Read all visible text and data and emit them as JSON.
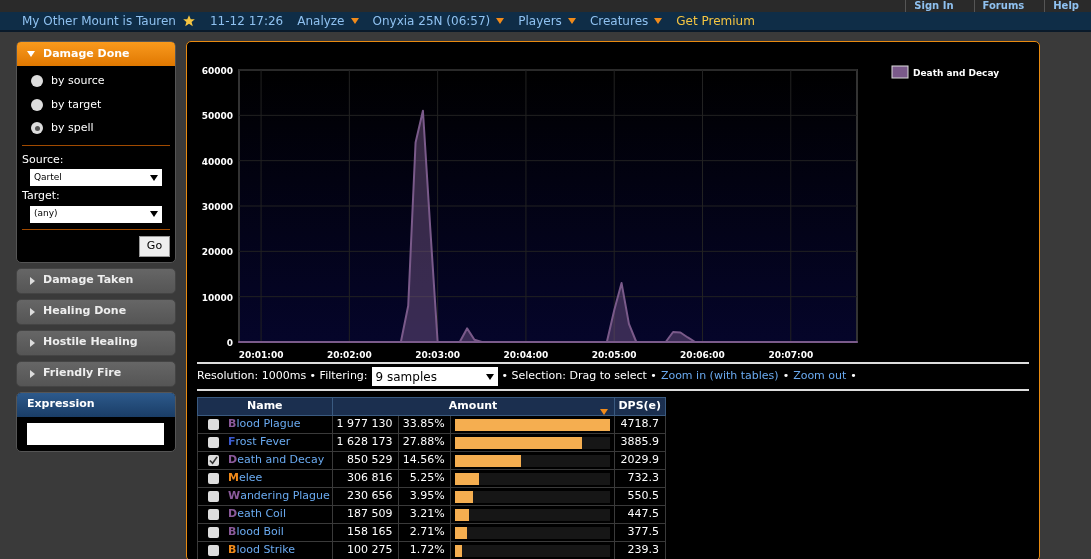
{
  "top_links": [
    "Sign In",
    "Forums",
    "Help"
  ],
  "nav": [
    {
      "label": "My Other Mount is Tauren",
      "kind": "title"
    },
    {
      "label": "11-12 17:26",
      "kind": "plain"
    },
    {
      "label": "Analyze",
      "kind": "menu"
    },
    {
      "label": "Onyxia 25N (06:57)",
      "kind": "menu"
    },
    {
      "label": "Players",
      "kind": "menu"
    },
    {
      "label": "Creatures",
      "kind": "menu"
    },
    {
      "label": "Get Premium",
      "kind": "premium"
    }
  ],
  "sidebar": {
    "active_panel": {
      "title": "Damage Done",
      "options": [
        {
          "label": "by source",
          "selected": false
        },
        {
          "label": "by target",
          "selected": false
        },
        {
          "label": "by spell",
          "selected": true
        }
      ],
      "source_label": "Source:",
      "source_value": "Qartel",
      "target_label": "Target:",
      "target_value": "(any)",
      "go": "Go"
    },
    "panels": [
      {
        "title": "Damage Taken"
      },
      {
        "title": "Healing Done"
      },
      {
        "title": "Hostile Healing"
      },
      {
        "title": "Friendly Fire"
      }
    ],
    "expression": {
      "title": "Expression"
    }
  },
  "chart": {
    "chart_data": {
      "type": "area",
      "grid": true,
      "categories": [
        null,
        null,
        null,
        "20:01:00",
        null,
        null,
        null,
        null,
        null,
        null,
        null,
        null,
        null,
        null,
        null,
        "20:02:00",
        null,
        null,
        null,
        null,
        null,
        null,
        null,
        null,
        null,
        null,
        null,
        "20:03:00",
        null,
        null,
        null,
        null,
        null,
        null,
        null,
        null,
        null,
        null,
        null,
        "20:04:00",
        null,
        null,
        null,
        null,
        null,
        null,
        null,
        null,
        null,
        null,
        null,
        "20:05:00",
        null,
        null,
        null,
        null,
        null,
        null,
        null,
        null,
        null,
        null,
        null,
        "20:06:00",
        null,
        null,
        null,
        null,
        null,
        null,
        null,
        null,
        null,
        null,
        null,
        "20:07:00",
        null,
        null,
        null,
        null,
        null,
        null,
        null,
        null,
        null
      ],
      "yticks": [
        0,
        10000,
        20000,
        30000,
        40000,
        50000,
        60000
      ],
      "ylim": [
        0,
        60000
      ],
      "series": [
        {
          "name": "Death and Decay",
          "color": "#7a5a8a",
          "values": [
            0,
            0,
            0,
            0,
            0,
            0,
            0,
            0,
            0,
            0,
            0,
            0,
            0,
            0,
            0,
            0,
            0,
            0,
            0,
            0,
            0,
            0,
            0,
            8000,
            44000,
            51000,
            25000,
            0,
            0,
            0,
            0,
            3000,
            500,
            0,
            0,
            0,
            0,
            0,
            0,
            0,
            0,
            0,
            0,
            0,
            0,
            0,
            0,
            0,
            0,
            0,
            0,
            7000,
            13000,
            4000,
            0,
            0,
            0,
            0,
            0,
            2200,
            2100,
            1000,
            0,
            0,
            0,
            0,
            0,
            0,
            0,
            0,
            0,
            0,
            0,
            0,
            0,
            0,
            0,
            0,
            0,
            0,
            0,
            0,
            0,
            0,
            0
          ]
        }
      ]
    }
  },
  "controls": {
    "resolution": "Resolution: 1000ms • Filtering:",
    "filter_value": "9 samples",
    "selection": "• Selection: Drag to select •",
    "zoom_in": "Zoom in (with tables)",
    "sep": "•",
    "zoom_out": "Zoom out",
    "end": "•"
  },
  "table": {
    "columns": [
      "Name",
      "Amount",
      "DPS(e)"
    ],
    "rows": [
      {
        "name": "Blood Plague",
        "color": "#8a5a9a",
        "checked": false,
        "amount": "1 977 130",
        "percent": "33.85%",
        "level": 1.0,
        "dps": "4718.7"
      },
      {
        "name": "Frost Fever",
        "color": "#3a5acf",
        "checked": false,
        "amount": "1 628 173",
        "percent": "27.88%",
        "level": 0.82,
        "dps": "3885.9"
      },
      {
        "name": "Death and Decay",
        "color": "#8a5a9a",
        "checked": true,
        "amount": "850 529",
        "percent": "14.56%",
        "level": 0.43,
        "dps": "2029.9"
      },
      {
        "name": "Melee",
        "color": "#f08a1a",
        "checked": false,
        "amount": "306 816",
        "percent": "5.25%",
        "level": 0.155,
        "dps": "732.3"
      },
      {
        "name": "Wandering Plague",
        "color": "#8a5a9a",
        "checked": false,
        "amount": "230 656",
        "percent": "3.95%",
        "level": 0.117,
        "dps": "550.5"
      },
      {
        "name": "Death Coil",
        "color": "#8a5a9a",
        "checked": false,
        "amount": "187 509",
        "percent": "3.21%",
        "level": 0.095,
        "dps": "447.5"
      },
      {
        "name": "Blood Boil",
        "color": "#8a5a9a",
        "checked": false,
        "amount": "158 165",
        "percent": "2.71%",
        "level": 0.08,
        "dps": "377.5"
      },
      {
        "name": "Blood Strike",
        "color": "#f08a1a",
        "checked": false,
        "amount": "100 275",
        "percent": "1.72%",
        "level": 0.05,
        "dps": "239.3"
      }
    ]
  }
}
